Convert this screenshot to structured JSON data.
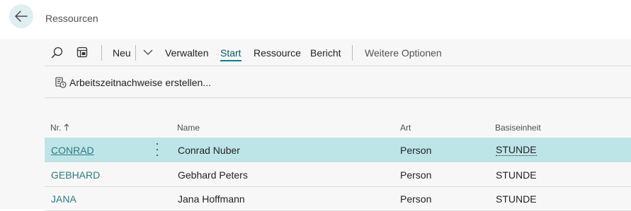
{
  "header": {
    "title": "Ressourcen",
    "back_icon": "arrow-left-icon"
  },
  "toolbar": {
    "search_icon": "search-icon",
    "layout_icon": "layout-icon",
    "new_label": "Neu",
    "chevron_icon": "chevron-down-icon",
    "items": [
      "Verwalten",
      "Start",
      "Ressource",
      "Bericht"
    ],
    "active": "Start",
    "more_label": "Weitere Optionen"
  },
  "action": {
    "icon": "timesheet-icon",
    "label": "Arbeitszeitnachweise erstellen..."
  },
  "table": {
    "columns": {
      "no": "Nr.",
      "name": "Name",
      "type": "Art",
      "unit": "Basiseinheit"
    },
    "sort_icon": "sort-ascending-icon",
    "rows": [
      {
        "no": "CONRAD",
        "name": "Conrad Nuber",
        "type": "Person",
        "unit": "STUNDE",
        "selected": true
      },
      {
        "no": "GEBHARD",
        "name": "Gebhard Peters",
        "type": "Person",
        "unit": "STUNDE",
        "selected": false
      },
      {
        "no": "JANA",
        "name": "Jana Hoffmann",
        "type": "Person",
        "unit": "STUNDE",
        "selected": false
      }
    ]
  },
  "colors": {
    "accent": "#00828a",
    "selected_row": "#bde5e8",
    "link": "#2f7a80"
  }
}
